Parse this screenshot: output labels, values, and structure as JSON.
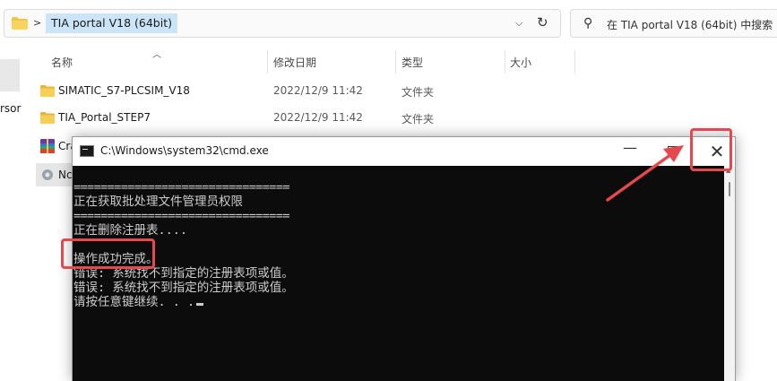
{
  "explorer": {
    "address": {
      "current_folder": "TIA portal V18 (64bit)",
      "separator": ">"
    },
    "search": {
      "placeholder": "在 TIA portal V18 (64bit) 中搜索"
    },
    "nav": {
      "truncated_item": "rsor"
    },
    "columns": [
      {
        "label": "名称"
      },
      {
        "label": "修改日期"
      },
      {
        "label": "类型"
      },
      {
        "label": "大小"
      }
    ],
    "rows": [
      {
        "name": "SIMATIC_S7-PLCSIM_V18",
        "date": "2022/12/9 11:42",
        "type": "文件夹",
        "icon": "folder-icon"
      },
      {
        "name": "TIA_Portal_STEP7",
        "date": "2022/12/9 11:42",
        "type": "文件夹",
        "icon": "folder-icon"
      },
      {
        "name": "Cra",
        "icon": "archive-icon"
      },
      {
        "name": "Nc",
        "icon": "batch-file-icon"
      }
    ]
  },
  "cmd": {
    "title": "C:\\Windows\\system32\\cmd.exe",
    "lines": [
      "================================",
      "正在获取批处理文件管理员权限",
      "================================",
      "正在删除注册表....",
      "",
      "操作成功完成。",
      "错误: 系统找不到指定的注册表项或值。",
      "错误: 系统找不到指定的注册表项或值。",
      "请按任意键继续. . ."
    ]
  },
  "colors": {
    "highlight": "#e5484d",
    "console_bg": "#0c0c0c",
    "console_text": "#cccccc",
    "address_selected": "#cce4f7",
    "folder": "#f4c542"
  }
}
